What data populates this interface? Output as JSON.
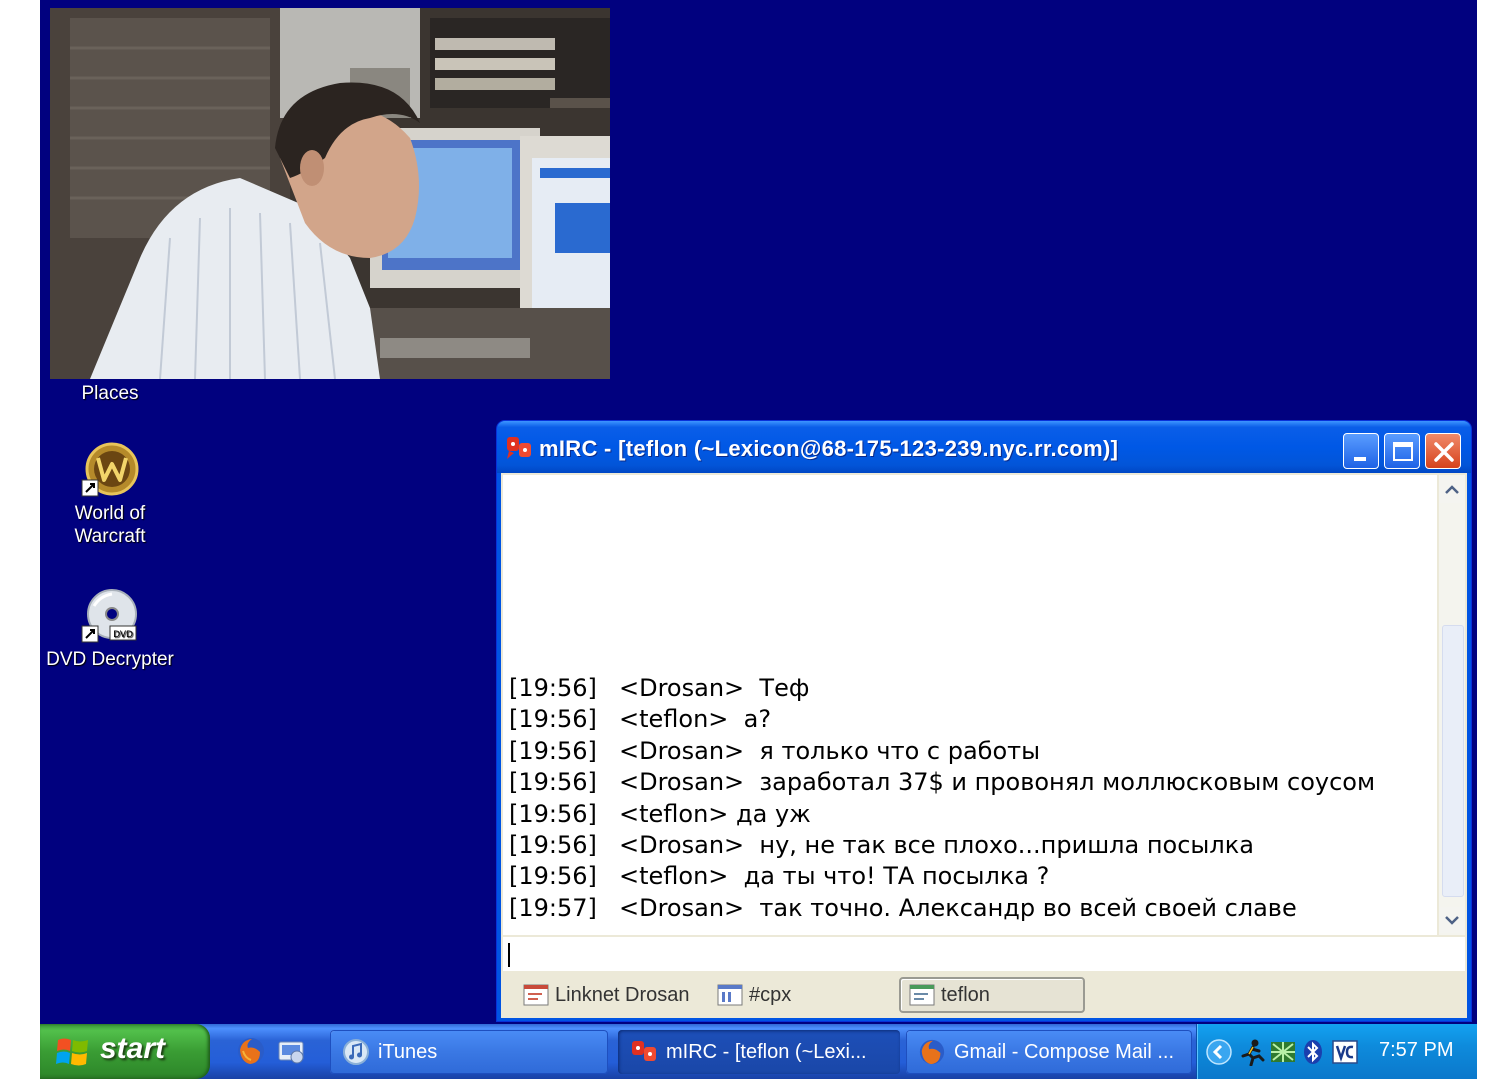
{
  "desktop": {
    "icons": [
      {
        "label": "Places"
      },
      {
        "label": "World of\nWarcraft"
      },
      {
        "label": "DVD Decrypter"
      }
    ]
  },
  "mirc": {
    "title": "mIRC - [teflon (~Lexicon@68-175-123-239.nyc.rr.com)]",
    "chat": [
      {
        "time": "[19:56]",
        "text": "<Drosan>  Теф"
      },
      {
        "time": "[19:56]",
        "text": "<teflon>  а?"
      },
      {
        "time": "[19:56]",
        "text": "<Drosan>  я только что с работы"
      },
      {
        "time": "[19:56]",
        "text": "<Drosan>  заработал 37$ и провонял моллюсковым соусом"
      },
      {
        "time": "[19:56]",
        "text": "<teflon> да уж"
      },
      {
        "time": "[19:56]",
        "text": "<Drosan>  ну, не так все плохо...пришла посылка"
      },
      {
        "time": "[19:56]",
        "text": "<teflon>  да ты что! ТА посылка ?"
      },
      {
        "time": "[19:57]",
        "text": "<Drosan>  так точно. Александр во всей своей славе"
      }
    ],
    "input_value": "",
    "switchbar": [
      {
        "label": "Linknet Drosan"
      },
      {
        "label": "#cpx"
      },
      {
        "label": "teflon"
      }
    ]
  },
  "taskbar": {
    "start_label": "start",
    "tasks": [
      {
        "label": "iTunes"
      },
      {
        "label": "mIRC - [teflon (~Lexi..."
      },
      {
        "label": "Gmail - Compose Mail ..."
      }
    ],
    "clock": "7:57 PM"
  },
  "colors": {
    "desktop_bg": "#01017f",
    "titlebar": "#0058e6",
    "taskbar": "#245ed8",
    "start_button": "#3a9d34",
    "tray": "#0e8bdc"
  },
  "icons": [
    "webcam-photo",
    "world-of-warcraft-icon",
    "dvd-decrypter-icon",
    "mirc-icon",
    "minimize-icon",
    "maximize-icon",
    "close-icon",
    "windows-logo-icon",
    "firefox-icon",
    "show-desktop-icon",
    "itunes-icon",
    "gmail-firefox-icon",
    "tray-chevron-icon",
    "tray-runner-icon",
    "tray-network-icon",
    "bluetooth-icon",
    "tray-antivirus-icon"
  ]
}
